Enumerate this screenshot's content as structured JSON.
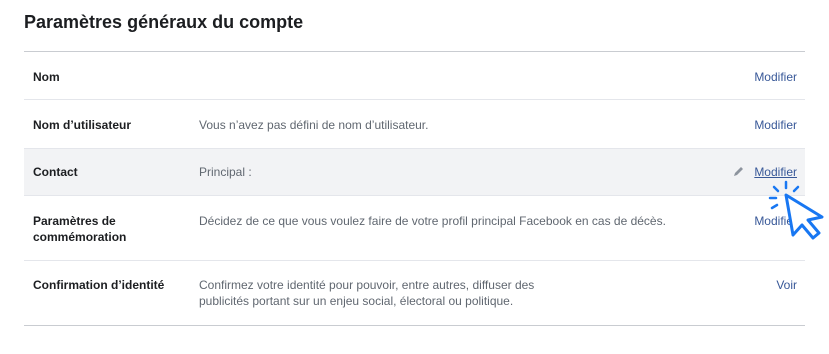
{
  "page": {
    "title": "Paramètres généraux du compte"
  },
  "rows": [
    {
      "label": "Nom",
      "content": "",
      "action": "Modifier"
    },
    {
      "label": "Nom d’utilisateur",
      "content": "Vous n’avez pas défini de nom d’utilisateur.",
      "action": "Modifier"
    },
    {
      "label": "Contact",
      "content": "Principal :",
      "action": "Modifier"
    },
    {
      "label": "Paramètres de commémoration",
      "content": "Décidez de ce que vous voulez faire de votre profil principal Facebook en cas de décès.",
      "action": "Modifier"
    },
    {
      "label": "Confirmation d’identité",
      "content": "Confirmez votre identité pour pouvoir, entre autres, diffuser des publicités portant sur un enjeu social, électoral ou politique.",
      "action": "Voir"
    }
  ],
  "colors": {
    "link": "#385898",
    "highlight_row": "#f2f3f5",
    "cursor": "#1877f2"
  },
  "icons": {
    "edit": "pencil-icon",
    "pointer": "hand-cursor-icon"
  }
}
